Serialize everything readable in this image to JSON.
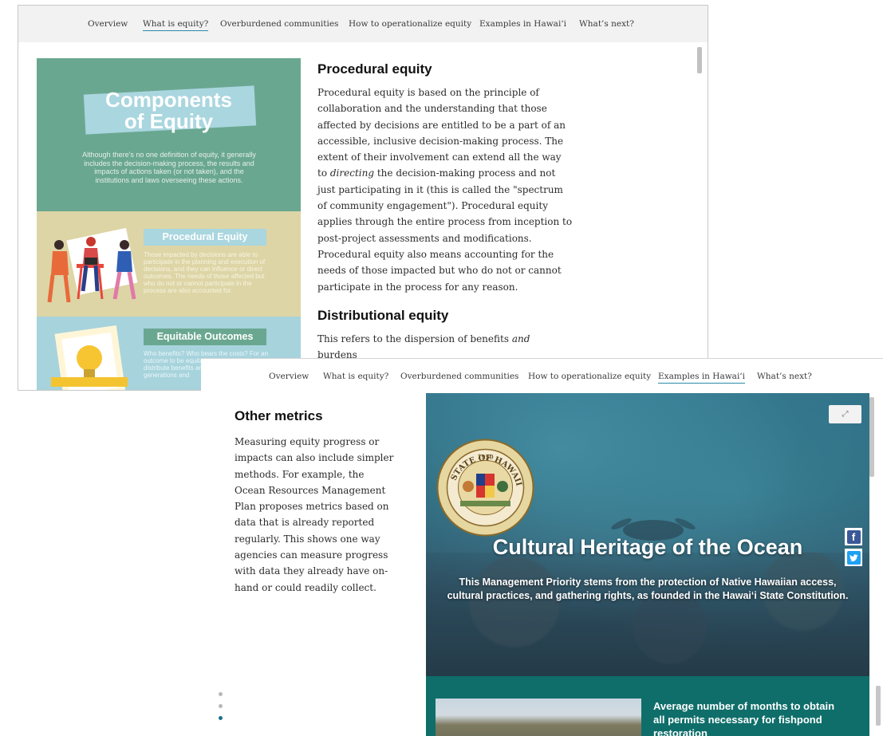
{
  "nav_items": [
    "Overview",
    "What is equity?",
    "Overburdened communities",
    "How to operationalize equity",
    "Examples in Hawai‘i",
    "What’s next?"
  ],
  "window1": {
    "active_tab": "What is equity?",
    "infographic": {
      "title_line1": "Components",
      "title_line2": "of Equity",
      "description": "Although there's no one definition of equity, it generally includes the decision-making process, the results and impacts of actions taken (or not taken), and the institutions and laws overseeing these actions.",
      "procedural_label": "Procedural Equity",
      "procedural_text": "Those impacted by decisions are able to participate in the planning and execution of decisions, and they can influence or direct outcomes. The needs of those affected but who do not or cannot participate in the process are also accounted for.",
      "outcomes_label": "Equitable Outcomes",
      "outcomes_text": "Who benefits? Who bears the costs? For an outcome to be equitable, it needs to distribute benefits and burdens across generations and"
    },
    "procedural_heading": "Procedural equity",
    "procedural_body_1": "Procedural equity is based on the principle of collaboration and the understanding that those affected by decisions are entitled to be a part of an accessible, inclusive decision-making process. The extent of their involvement can extend all the way to",
    "procedural_body_em": "directing",
    "procedural_body_2": "the decision-making process and not just participating in it (this is called the \"spectrum of community engagement\"). Procedural equity applies through the entire process from inception to post-project assessments and modifications. Procedural equity also means accounting for the needs of those impacted but who do not or cannot participate in the process for any reason.",
    "distributional_heading": "Distributional equity",
    "distributional_body_1": "This refers to the dispersion of benefits",
    "distributional_body_em": "and",
    "distributional_body_2": "burdens"
  },
  "window2": {
    "active_tab": "Examples in Hawai‘i",
    "left_heading": "Other metrics",
    "left_body": "Measuring equity progress or impacts can also include simpler methods. For example, the Ocean Resources Management Plan proposes metrics based on data that is already reported regularly. This shows one way agencies can measure progress with data they already have on-hand or could readily collect.",
    "hero_title": "Cultural Heritage of the Ocean",
    "hero_subtitle": "This Management Priority stems from the protection of Native Hawaiian access, cultural practices, and gathering rights, as founded in the Hawai‘i State Constitution.",
    "seal_text_top": "STATE OF HAWAII",
    "seal_year": "1959",
    "stat_text": "Average number of months to obtain all permits necessary for fishpond restoration",
    "expand_icon": "external-link-icon",
    "share": [
      "facebook-icon",
      "twitter-icon"
    ],
    "colors": {
      "teal_panel": "#0f6e6a",
      "facebook": "#3b5998",
      "twitter": "#1da1f2",
      "nav_underline": "#2a8aa8"
    }
  }
}
